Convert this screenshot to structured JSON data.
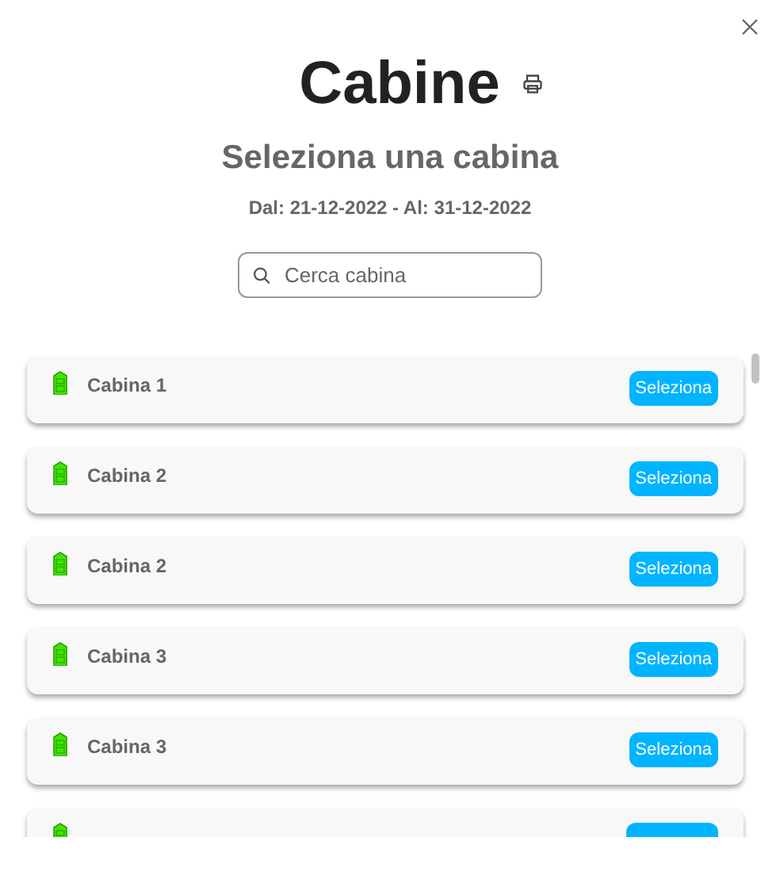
{
  "title": "Cabine",
  "subtitle": "Seleziona una cabina",
  "period": "Dal: 21-12-2022 - Al: 31-12-2022",
  "search": {
    "placeholder": "Cerca cabina"
  },
  "cabins": [
    {
      "name": "Cabina 1",
      "action": "Seleziona",
      "color": "#3ee600"
    },
    {
      "name": "Cabina 2",
      "action": "Seleziona",
      "color": "#3ee600"
    },
    {
      "name": "Cabina 2",
      "action": "Seleziona",
      "color": "#3ee600"
    },
    {
      "name": "Cabina 3",
      "action": "Seleziona",
      "color": "#3ee600"
    },
    {
      "name": "Cabina 3",
      "action": "Seleziona",
      "color": "#3ee600"
    },
    {
      "kind": "partial",
      "color": "#3ee600"
    }
  ]
}
